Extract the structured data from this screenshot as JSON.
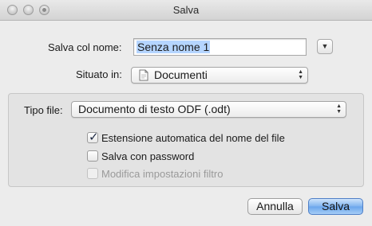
{
  "window": {
    "title": "Salva"
  },
  "save_name": {
    "label": "Salva col nome:",
    "value": "Senza nome 1"
  },
  "location": {
    "label": "Situato in:",
    "value": "Documenti"
  },
  "file_type": {
    "label": "Tipo file:",
    "value": "Documento di testo ODF (.odt)"
  },
  "options": {
    "auto_extension": {
      "label": "Estensione automatica del nome del file",
      "checked": true
    },
    "password": {
      "label": "Salva con password",
      "checked": false
    },
    "filter_settings": {
      "label": "Modifica impostazioni filtro",
      "checked": false,
      "enabled": false
    }
  },
  "buttons": {
    "cancel": "Annulla",
    "save": "Salva"
  },
  "colors": {
    "primary_button": "#7fb3ef",
    "selection": "#b5d5ff"
  }
}
